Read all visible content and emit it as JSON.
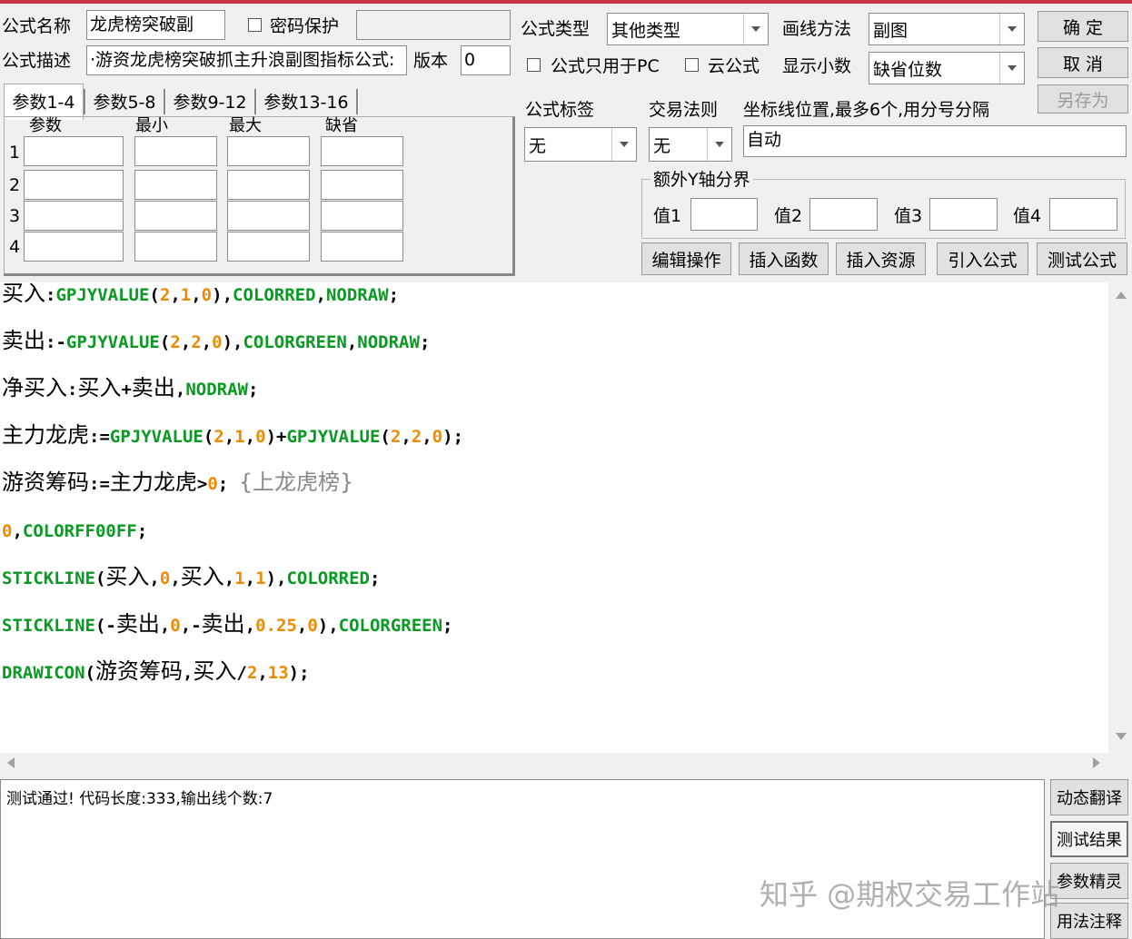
{
  "header": {
    "formula_name_label": "公式名称",
    "formula_name_value": "龙虎榜突破副",
    "password_label": "密码保护",
    "formula_desc_label": "公式描述",
    "formula_desc_value": "·游资龙虎榜突破抓主升浪副图指标公式:",
    "version_label": "版本",
    "version_value": "0",
    "formula_type_label": "公式类型",
    "formula_type_value": "其他类型",
    "draw_method_label": "画线方法",
    "draw_method_value": "副图",
    "pc_only_label": "公式只用于PC",
    "cloud_label": "云公式",
    "decimals_label": "显示小数",
    "decimals_value": "缺省位数",
    "confirm_btn": "确  定",
    "cancel_btn": "取  消",
    "save_as_btn": "另存为"
  },
  "tabs": [
    "参数1-4",
    "参数5-8",
    "参数9-12",
    "参数13-16"
  ],
  "params": {
    "headers": [
      "参数",
      "最小",
      "最大",
      "缺省"
    ],
    "rows": [
      "1",
      "2",
      "3",
      "4"
    ]
  },
  "tag_label": "公式标签",
  "tag_value": "无",
  "trade_rule_label": "交易法则",
  "trade_rule_value": "无",
  "axis_label": "坐标线位置,最多6个,用分号分隔",
  "axis_value": "自动",
  "extra_y": {
    "title": "额外Y轴分界",
    "labels": [
      "值1",
      "值2",
      "值3",
      "值4"
    ]
  },
  "actions": [
    "编辑操作",
    "插入函数",
    "插入资源",
    "引入公式",
    "测试公式"
  ],
  "code": {
    "l1": [
      "买入",
      ":",
      "GPJYVALUE",
      "(",
      "2",
      ",",
      "1",
      ",",
      "0",
      "),",
      "COLORRED",
      ",",
      "NODRAW",
      ";"
    ],
    "l2": [
      "卖出",
      ":-",
      "GPJYVALUE",
      "(",
      "2",
      ",",
      "2",
      ",",
      "0",
      "),",
      "COLORGREEN",
      ",",
      "NODRAW",
      ";"
    ],
    "l3": [
      "净买入",
      ":",
      "买入",
      "+",
      "卖出",
      ",",
      "NODRAW",
      ";"
    ],
    "l4": [
      "主力龙虎",
      ":=",
      "GPJYVALUE",
      "(",
      "2",
      ",",
      "1",
      ",",
      "0",
      ")+",
      "GPJYVALUE",
      "(",
      "2",
      ",",
      "2",
      ",",
      "0",
      ");"
    ],
    "l5": [
      "游资筹码",
      ":=",
      "主力龙虎",
      ">",
      "0",
      "; ",
      "{上龙虎榜}"
    ],
    "l6": [
      "0",
      ",",
      "COLORFF00FF",
      ";"
    ],
    "l7": [
      "STICKLINE",
      "(",
      "买入",
      ",",
      "0",
      ",",
      "买入",
      ",",
      "1",
      ",",
      "1",
      "),",
      "COLORRED",
      ";"
    ],
    "l8": [
      "STICKLINE",
      "(-",
      "卖出",
      ",",
      "0",
      ",-",
      "卖出",
      ",",
      "0.25",
      ",",
      "0",
      "),",
      "COLORGREEN",
      ";"
    ],
    "l9": [
      "DRAWICON",
      "(",
      "游资筹码",
      ",",
      "买入",
      "/",
      "2",
      ",",
      "13",
      ");"
    ]
  },
  "output_text": "测试通过! 代码长度:333,输出线个数:7",
  "side_buttons": [
    "动态翻译",
    "测试结果",
    "参数精灵",
    "用法注释"
  ],
  "watermark": "知乎 @期权交易工作站",
  "colors": {
    "keyword": "#0a9a24",
    "number": "#f28a00",
    "comment": "#888888",
    "accent_bar": "#cc3344"
  }
}
